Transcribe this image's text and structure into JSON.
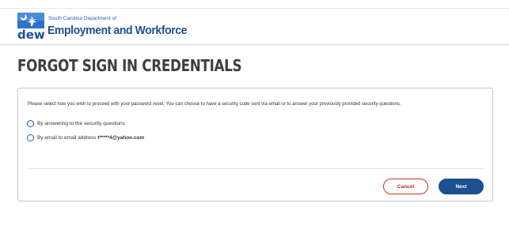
{
  "header": {
    "logo_text": "dew",
    "agency_small": "South Carolina Department of",
    "agency_big": "Employment and Workforce"
  },
  "page": {
    "title": "FORGOT SIGN IN CREDENTIALS"
  },
  "form": {
    "instructions": "Please select how you wish to proceed with your password reset. You can choose to have a security code sent via email or to answer your previously provided security questions.",
    "option_questions": "By answering to the security questions",
    "option_email_prefix": "By email to email address ",
    "option_email_address": "t*****4@yahoo.com",
    "cancel_label": "Cancel",
    "next_label": "Next"
  },
  "colors": {
    "brand_blue": "#1d4f91",
    "cancel_red": "#b03028"
  }
}
